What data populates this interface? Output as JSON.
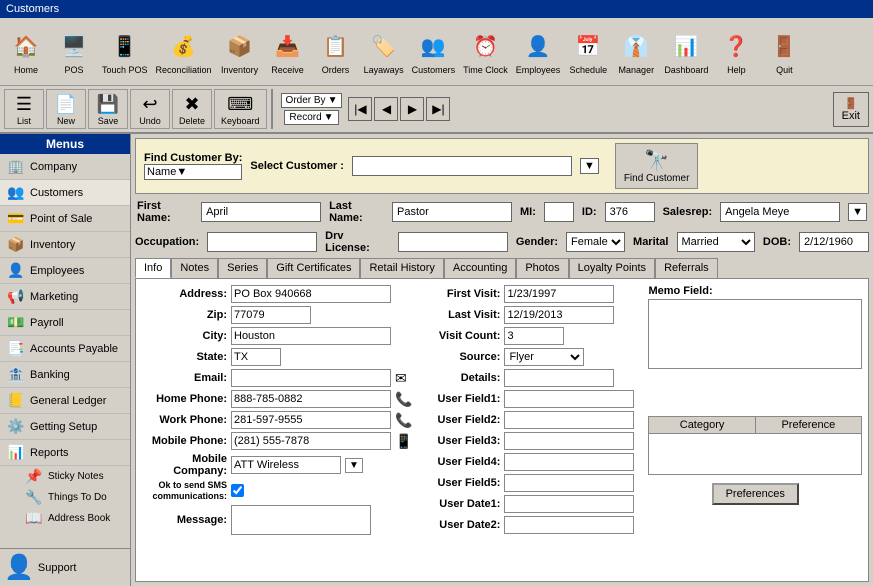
{
  "titleBar": {
    "label": "Customers"
  },
  "toolbar": {
    "buttons": [
      {
        "id": "home",
        "icon": "🏠",
        "label": "Home"
      },
      {
        "id": "pos",
        "icon": "🖥️",
        "label": "POS"
      },
      {
        "id": "touch-pos",
        "icon": "📱",
        "label": "Touch POS"
      },
      {
        "id": "reconciliation",
        "icon": "💰",
        "label": "Reconciliation"
      },
      {
        "id": "inventory",
        "icon": "📦",
        "label": "Inventory"
      },
      {
        "id": "receive",
        "icon": "📥",
        "label": "Receive"
      },
      {
        "id": "orders",
        "icon": "📋",
        "label": "Orders"
      },
      {
        "id": "layaways",
        "icon": "🏷️",
        "label": "Layaways"
      },
      {
        "id": "customers",
        "icon": "👥",
        "label": "Customers"
      },
      {
        "id": "time-clock",
        "icon": "⏰",
        "label": "Time Clock"
      },
      {
        "id": "employees",
        "icon": "👤",
        "label": "Employees"
      },
      {
        "id": "schedule",
        "icon": "📅",
        "label": "Schedule"
      },
      {
        "id": "manager",
        "icon": "👔",
        "label": "Manager"
      },
      {
        "id": "dashboard",
        "icon": "📊",
        "label": "Dashboard"
      },
      {
        "id": "help",
        "icon": "❓",
        "label": "Help"
      },
      {
        "id": "quit",
        "icon": "🚪",
        "label": "Quit"
      }
    ]
  },
  "toolbar2": {
    "buttons": [
      {
        "id": "list",
        "icon": "☰",
        "label": "List"
      },
      {
        "id": "new",
        "icon": "📄",
        "label": "New"
      },
      {
        "id": "save",
        "icon": "💾",
        "label": "Save"
      },
      {
        "id": "undo",
        "icon": "↩",
        "label": "Undo"
      },
      {
        "id": "delete",
        "icon": "✖",
        "label": "Delete"
      },
      {
        "id": "keyboard",
        "icon": "⌨",
        "label": "Keyboard"
      }
    ],
    "orderBy": "Order By",
    "record": "Record",
    "exit": "Exit"
  },
  "sidebar": {
    "menusHeader": "Menus",
    "items": [
      {
        "id": "company",
        "icon": "🏢",
        "label": "Company"
      },
      {
        "id": "customers",
        "icon": "👥",
        "label": "Customers",
        "active": true
      },
      {
        "id": "point-of-sale",
        "icon": "💳",
        "label": "Point of Sale"
      },
      {
        "id": "inventory",
        "icon": "📦",
        "label": "Inventory"
      },
      {
        "id": "employees",
        "icon": "👤",
        "label": "Employees"
      },
      {
        "id": "marketing",
        "icon": "📢",
        "label": "Marketing"
      },
      {
        "id": "payroll",
        "icon": "💵",
        "label": "Payroll"
      },
      {
        "id": "accounts-payable",
        "icon": "📑",
        "label": "Accounts Payable"
      },
      {
        "id": "banking",
        "icon": "🏦",
        "label": "Banking"
      },
      {
        "id": "general-ledger",
        "icon": "📒",
        "label": "General Ledger"
      },
      {
        "id": "getting-setup",
        "icon": "⚙️",
        "label": "Getting Setup"
      },
      {
        "id": "reports",
        "icon": "📊",
        "label": "Reports"
      }
    ],
    "subItems": [
      {
        "id": "sticky-notes",
        "icon": "📌",
        "label": "Sticky Notes"
      },
      {
        "id": "things-to-do",
        "icon": "🔧",
        "label": "Things To Do"
      },
      {
        "id": "address-book",
        "icon": "📖",
        "label": "Address Book"
      }
    ],
    "support": "Support"
  },
  "findBar": {
    "findLabel": "Find Customer By:",
    "findByValue": "Name",
    "selectLabel": "Select Customer :",
    "findBtnLabel": "Find\nCustomer"
  },
  "customer": {
    "firstNameLabel": "First Name:",
    "firstName": "April",
    "lastNameLabel": "Last Name:",
    "lastName": "Pastor",
    "miLabel": "MI:",
    "mi": "",
    "idLabel": "ID:",
    "id": "376",
    "salesrepLabel": "Salesrep:",
    "salesrep": "Angela Meye",
    "occupationLabel": "Occupation:",
    "occupation": "",
    "drvLicenseLabel": "Drv License:",
    "drvLicense": "",
    "genderLabel": "Gender:",
    "gender": "Female",
    "maritalLabel": "Marital",
    "marital": "Married",
    "dobLabel": "DOB:",
    "dob": "2/12/1960"
  },
  "tabs": [
    {
      "id": "info",
      "label": "Info",
      "active": true
    },
    {
      "id": "notes",
      "label": "Notes"
    },
    {
      "id": "series",
      "label": "Series"
    },
    {
      "id": "gift-certificates",
      "label": "Gift Certificates"
    },
    {
      "id": "retail-history",
      "label": "Retail History"
    },
    {
      "id": "accounting",
      "label": "Accounting"
    },
    {
      "id": "photos",
      "label": "Photos"
    },
    {
      "id": "loyalty-points",
      "label": "Loyalty Points"
    },
    {
      "id": "referrals",
      "label": "Referrals"
    }
  ],
  "infoTab": {
    "addressLabel": "Address:",
    "address": "PO Box 940668",
    "zipLabel": "Zip:",
    "zip": "77079",
    "cityLabel": "City:",
    "city": "Houston",
    "stateLabel": "State:",
    "state": "TX",
    "emailLabel": "Email:",
    "email": "",
    "homePhoneLabel": "Home Phone:",
    "homePhone": "888-785-0882",
    "workPhoneLabel": "Work Phone:",
    "workPhone": "281-597-9555",
    "mobilePhoneLabel": "Mobile Phone:",
    "mobilePhone": "(281) 555-7878",
    "mobileCompanyLabel": "Mobile Company:",
    "mobileCompany": "ATT Wireless",
    "smsLabel": "Ok to send SMS communications:",
    "smsChecked": true,
    "messageLabel": "Message:",
    "message": "",
    "firstVisitLabel": "First Visit:",
    "firstVisit": "1/23/1997",
    "lastVisitLabel": "Last Visit:",
    "lastVisit": "12/19/2013",
    "visitCountLabel": "Visit Count:",
    "visitCount": "3",
    "sourceLabel": "Source:",
    "source": "Flyer",
    "detailsLabel": "Details:",
    "details": "",
    "userField1Label": "User Field1:",
    "userField1": "",
    "userField2Label": "User Field2:",
    "userField2": "",
    "userField3Label": "User Field3:",
    "userField3": "",
    "userField4Label": "User Field4:",
    "userField4": "",
    "userField5Label": "User Field5:",
    "userField5": "",
    "userDate1Label": "User Date1:",
    "userDate1": "",
    "userDate2Label": "User Date2:",
    "userDate2": "",
    "memoFieldLabel": "Memo Field:",
    "categoryHeader": "Category",
    "preferenceHeader": "Preference",
    "preferencesBtnLabel": "Preferences"
  }
}
